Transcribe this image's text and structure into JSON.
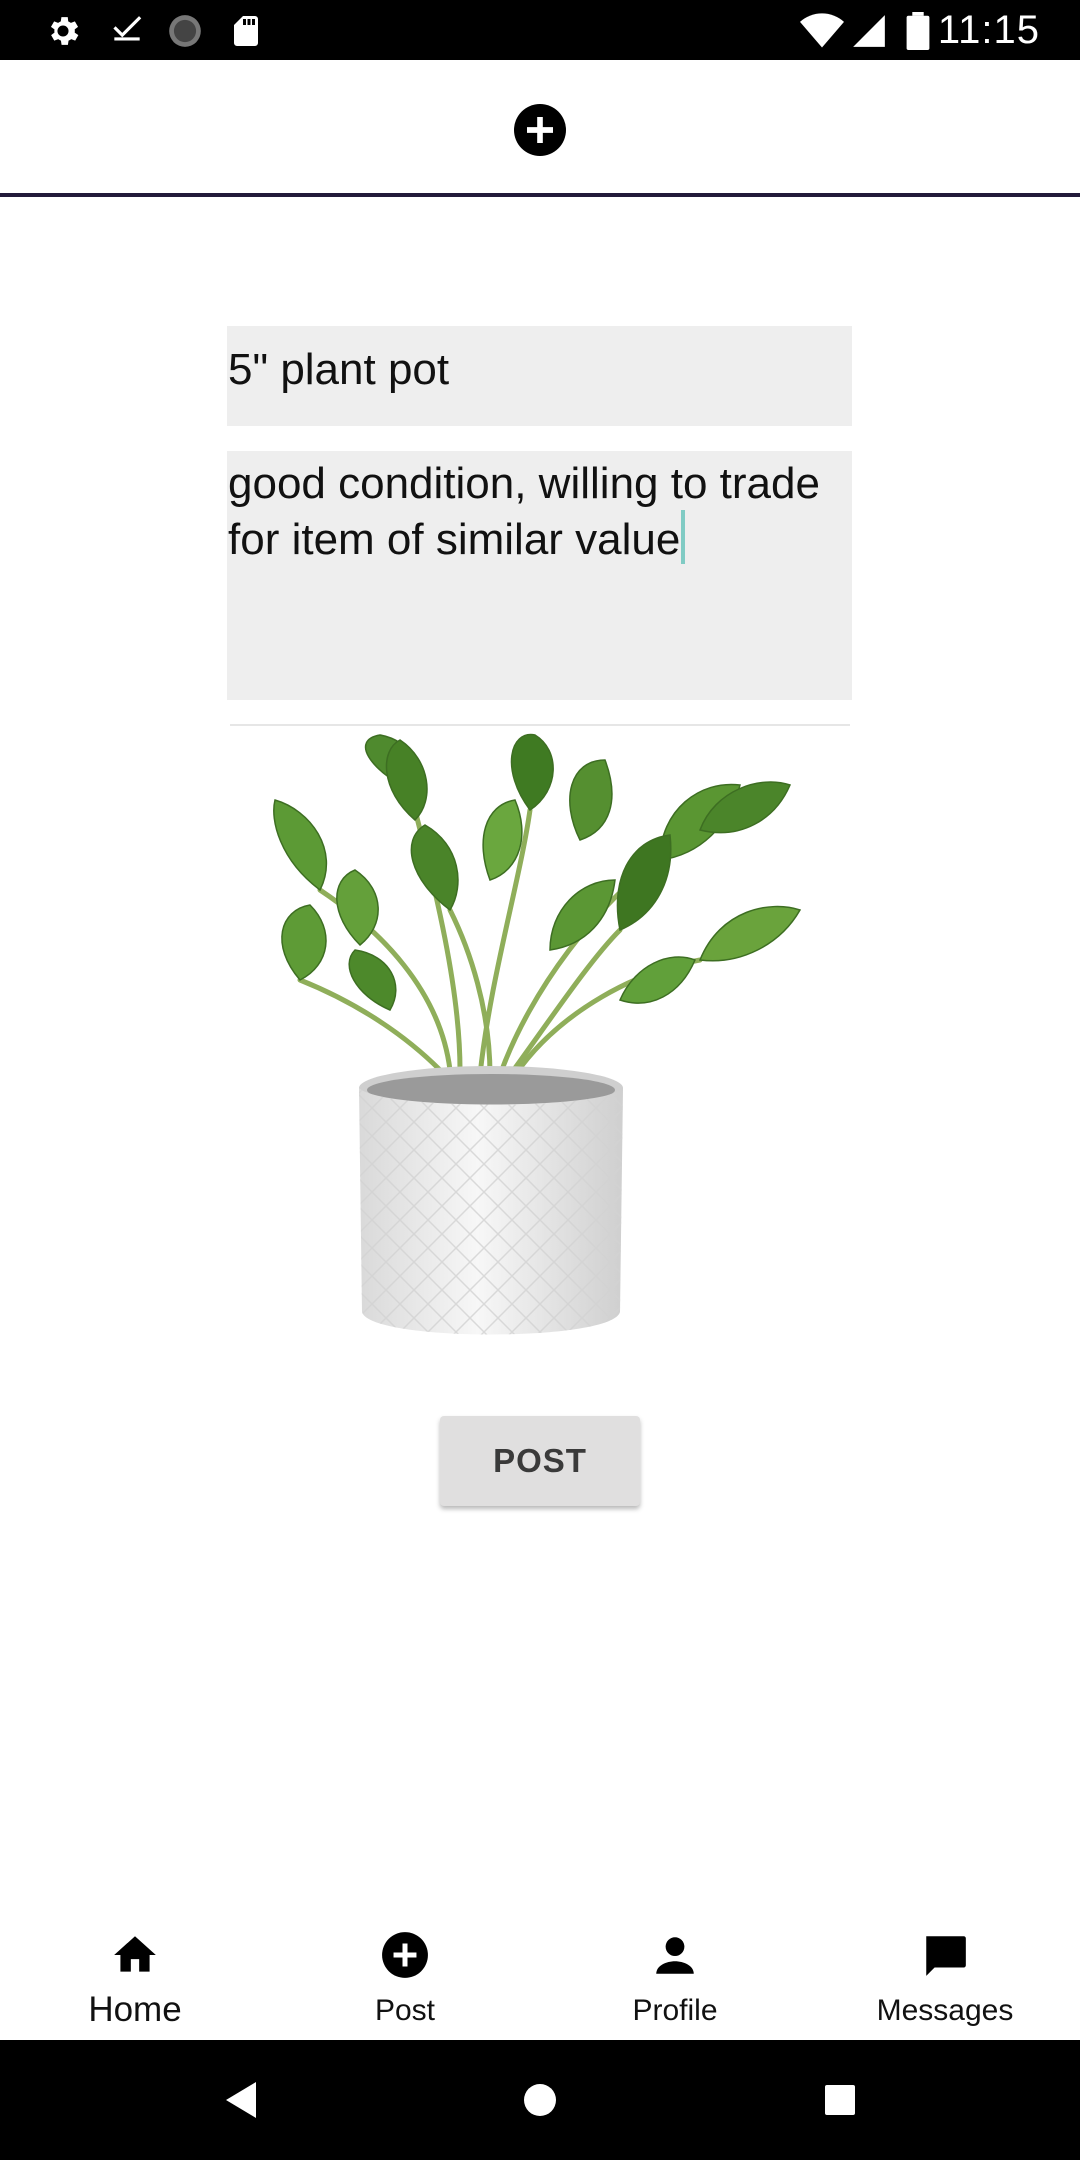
{
  "status_bar": {
    "time": "11:15",
    "icons": [
      "settings-icon",
      "download-done-icon",
      "sync-icon",
      "sd-card-icon",
      "wifi-icon",
      "signal-icon",
      "battery-icon"
    ]
  },
  "top_bar": {
    "icon": "add-circle-icon"
  },
  "form": {
    "title_value": "5\" plant pot",
    "description_value": "good condition, willing to trade for item of similar value"
  },
  "image": {
    "alt": "plant-in-white-pot"
  },
  "post_button": {
    "label": "POST"
  },
  "bottom_nav": {
    "items": [
      {
        "label": "Home",
        "icon": "home-icon",
        "active": true
      },
      {
        "label": "Post",
        "icon": "add-circle-icon",
        "active": false
      },
      {
        "label": "Profile",
        "icon": "person-icon",
        "active": false
      },
      {
        "label": "Messages",
        "icon": "chat-bubble-icon",
        "active": false
      }
    ]
  },
  "system_nav": {
    "icons": [
      "back-icon",
      "home-circle-icon",
      "recents-icon"
    ]
  },
  "colors": {
    "top_bar_divider": "#221a3a",
    "field_background": "#eeeeee",
    "caret": "#80cbc4",
    "button_background": "#e0dfdf"
  }
}
